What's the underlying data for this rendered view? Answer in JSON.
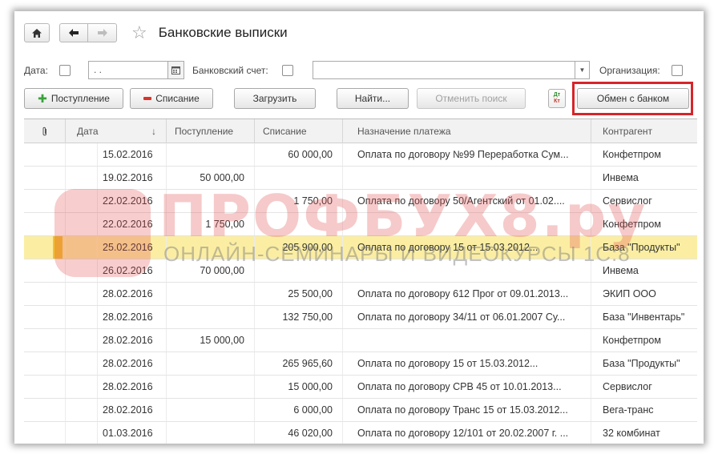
{
  "window": {
    "title": "Банковские выписки"
  },
  "filters": {
    "date_label": "Дата:",
    "date_value": ". .",
    "account_label": "Банковский счет:",
    "account_value": "",
    "org_label": "Организация:"
  },
  "toolbar": {
    "receipt": "Поступление",
    "writeoff": "Списание",
    "load": "Загрузить",
    "find": "Найти...",
    "cancel_search": "Отменить поиск",
    "dt_label": "Дт",
    "kt_label": "Кт",
    "bank_exchange": "Обмен с банком"
  },
  "table": {
    "headers": {
      "date": "Дата",
      "sort_arrow": "↓",
      "receipt": "Поступление",
      "writeoff": "Списание",
      "purpose": "Назначение платежа",
      "counterparty": "Контрагент"
    },
    "rows": [
      {
        "date": "15.02.2016",
        "receipt": "",
        "writeoff": "60 000,00",
        "purpose": "Оплата по договору №99 Переработка Сум...",
        "counterparty": "Конфетпром",
        "posted": true
      },
      {
        "date": "19.02.2016",
        "receipt": "50 000,00",
        "writeoff": "",
        "purpose": "",
        "counterparty": "Инвема",
        "posted": true
      },
      {
        "date": "22.02.2016",
        "receipt": "",
        "writeoff": "1 750,00",
        "purpose": "Оплата по договору 50/Агентский от 01.02....",
        "counterparty": "Сервислог",
        "posted": true
      },
      {
        "date": "22.02.2016",
        "receipt": "1 750,00",
        "writeoff": "",
        "purpose": "",
        "counterparty": "Конфетпром",
        "posted": true
      },
      {
        "date": "25.02.2016",
        "receipt": "",
        "writeoff": "205 900,00",
        "purpose": "Оплата по договору 15 от 15.03.2012...",
        "counterparty": "База \"Продукты\"",
        "posted": true,
        "selected": true
      },
      {
        "date": "26.02.2016",
        "receipt": "70 000,00",
        "writeoff": "",
        "purpose": "",
        "counterparty": "Инвема",
        "posted": true
      },
      {
        "date": "28.02.2016",
        "receipt": "",
        "writeoff": "25 500,00",
        "purpose": "Оплата по договору 612 Прог от 09.01.2013...",
        "counterparty": "ЭКИП ООО",
        "posted": false
      },
      {
        "date": "28.02.2016",
        "receipt": "",
        "writeoff": "132 750,00",
        "purpose": "Оплата по договору 34/11 от 06.01.2007 Су...",
        "counterparty": "База \"Инвентарь\"",
        "posted": true
      },
      {
        "date": "28.02.2016",
        "receipt": "15 000,00",
        "writeoff": "",
        "purpose": "",
        "counterparty": "Конфетпром",
        "posted": true
      },
      {
        "date": "28.02.2016",
        "receipt": "",
        "writeoff": "265 965,60",
        "purpose": "Оплата по договору 15 от 15.03.2012...",
        "counterparty": "База \"Продукты\"",
        "posted": false
      },
      {
        "date": "28.02.2016",
        "receipt": "",
        "writeoff": "15 000,00",
        "purpose": "Оплата по договору СРВ 45 от 10.01.2013...",
        "counterparty": "Сервислог",
        "posted": false
      },
      {
        "date": "28.02.2016",
        "receipt": "",
        "writeoff": "6 000,00",
        "purpose": "Оплата по договору Транс 15 от 15.03.2012...",
        "counterparty": "Вега-транс",
        "posted": true
      },
      {
        "date": "01.03.2016",
        "receipt": "",
        "writeoff": "46 020,00",
        "purpose": "Оплата по договору 12/101 от 20.02.2007 г. ...",
        "counterparty": "32 комбинат",
        "posted": true
      }
    ]
  },
  "watermark": {
    "brand": "ПРОФБУХ8.ру",
    "tagline": "ОНЛАЙН-СЕМИНАРЫ И ВИДЕОКУРСЫ 1С:8"
  },
  "colors": {
    "selected_row": "#fbeea3",
    "selected_marker": "#f2c22c",
    "highlight_box": "#d6252a",
    "posted_check": "#2e9a2e"
  },
  "icons": {
    "home": "home-icon",
    "back": "arrow-left-icon",
    "forward": "arrow-right-icon",
    "favorite": "star-icon",
    "calendar": "calendar-icon",
    "attachment": "paperclip-icon"
  }
}
